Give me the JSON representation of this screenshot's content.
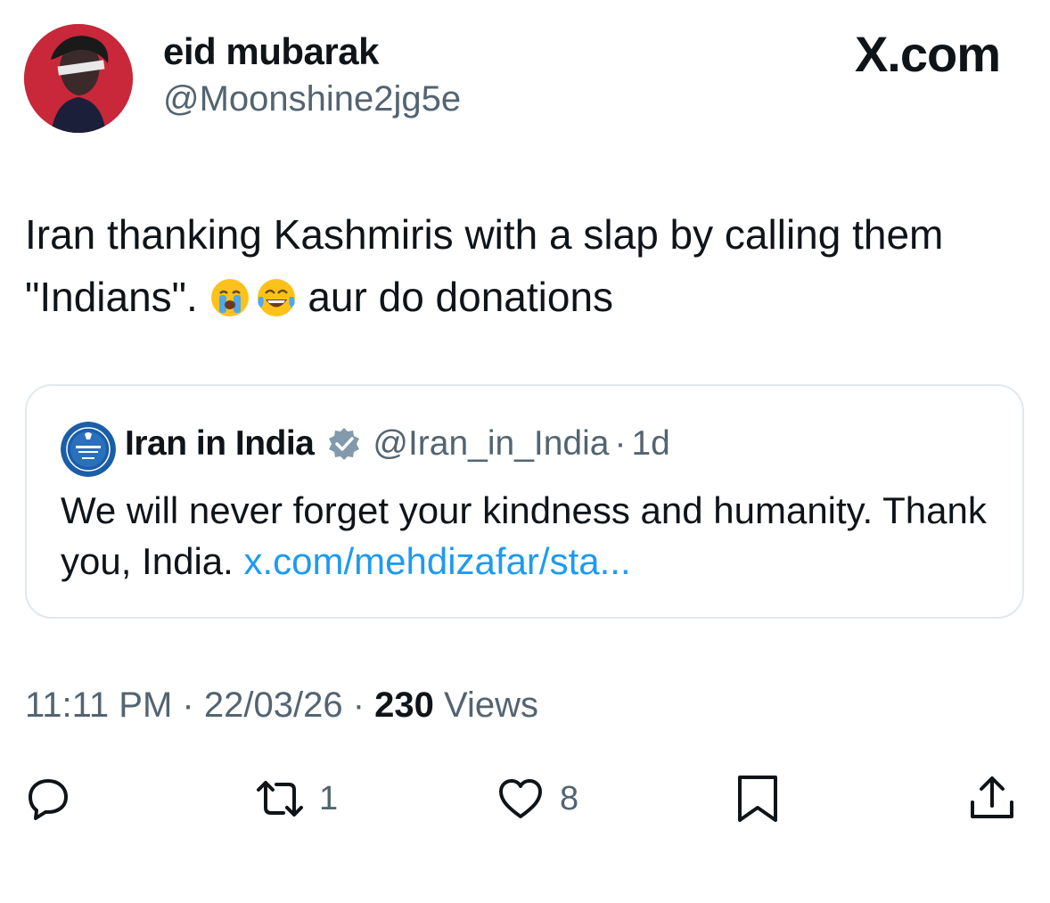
{
  "tweet": {
    "author": {
      "display_name": "eid mubarak",
      "handle": "@Moonshine2jg5e",
      "avatar_icon": "profile-avatar"
    },
    "brand": "X.com",
    "text_part1": "Iran thanking Kashmiris with a slap by calling them \"Indians\". ",
    "text_part2": " aur do donations",
    "emoji_1": "loudly-crying-face",
    "emoji_2": "face-with-tears-of-joy",
    "quote": {
      "display_name": "Iran in India",
      "verified_icon": "verified-badge-gray",
      "handle": "@Iran_in_India",
      "separator": "·",
      "age": "1d",
      "text": "We will never forget your kindness and humanity. Thank you, India. ",
      "link_text": "x.com/mehdizafar/sta..."
    },
    "time": "11:11 PM",
    "date": "22/03/26",
    "dot": "·",
    "views_count": "230",
    "views_label": "Views",
    "actions": {
      "reply_icon": "reply-icon",
      "retweet_icon": "retweet-icon",
      "retweet_count": "1",
      "like_icon": "heart-icon",
      "like_count": "8",
      "bookmark_icon": "bookmark-icon",
      "share_icon": "share-icon"
    }
  },
  "colors": {
    "text_primary": "#0f1419",
    "text_secondary": "#536471",
    "link": "#1d9bf0",
    "border": "#e1e8ed"
  }
}
